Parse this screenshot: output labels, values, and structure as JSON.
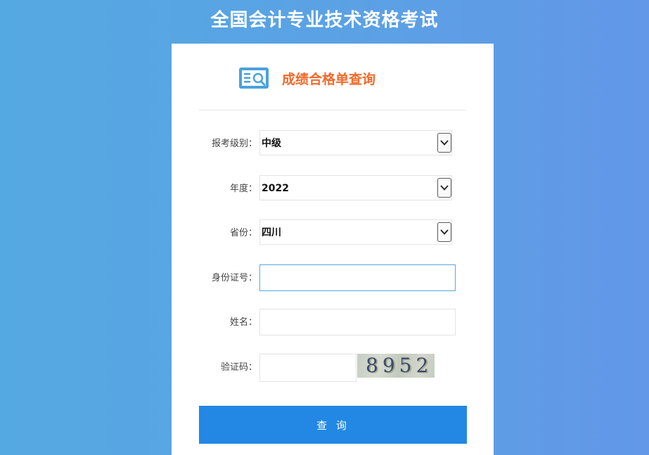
{
  "header": {
    "title": "全国会计专业技术资格考试"
  },
  "card": {
    "icon": "score-search-icon",
    "title": "成绩合格单查询"
  },
  "form": {
    "level": {
      "label": "报考级别：",
      "value": "中级"
    },
    "year": {
      "label": "年度：",
      "value": "2022"
    },
    "province": {
      "label": "省份：",
      "value": "四川"
    },
    "id_number": {
      "label": "身份证号：",
      "value": "",
      "placeholder": ""
    },
    "name": {
      "label": "姓名：",
      "value": "",
      "placeholder": ""
    },
    "captcha": {
      "label": "验证码：",
      "value": "",
      "code": "8952"
    },
    "submit_label": "查 询"
  },
  "colors": {
    "background_start": "#55a9e2",
    "background_end": "#6397e8",
    "title_accent": "#f06a2b",
    "button": "#2387e4",
    "focus_border": "#59a9e0"
  }
}
